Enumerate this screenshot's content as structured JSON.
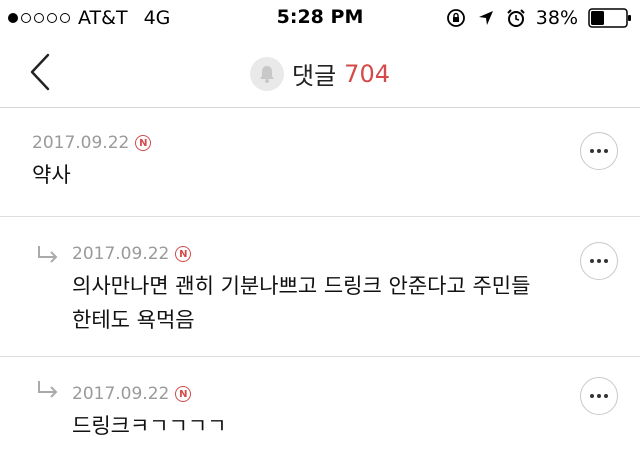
{
  "status_bar": {
    "carrier": "AT&T",
    "network": "4G",
    "time": "5:28 PM",
    "battery": "38%",
    "battery_level": 0.38,
    "signal_bars_filled": 1,
    "signal_bars_total": 5
  },
  "nav": {
    "title": "댓글",
    "count": "704",
    "accent_color": "#d44a4a"
  },
  "comments": [
    {
      "date": "2017.09.22",
      "badge": "N",
      "text": "약사",
      "is_reply": false
    },
    {
      "date": "2017.09.22",
      "badge": "N",
      "text_line1": "의사만나면 괜히 기분나쁘고 드링크 안준다고 주민들",
      "text_line2": "한테도 욕먹음",
      "is_reply": true
    },
    {
      "date": "2017.09.22",
      "badge": "N",
      "text": "드링크ㅋㄱㄱㄱㄱ",
      "is_reply": true
    }
  ]
}
